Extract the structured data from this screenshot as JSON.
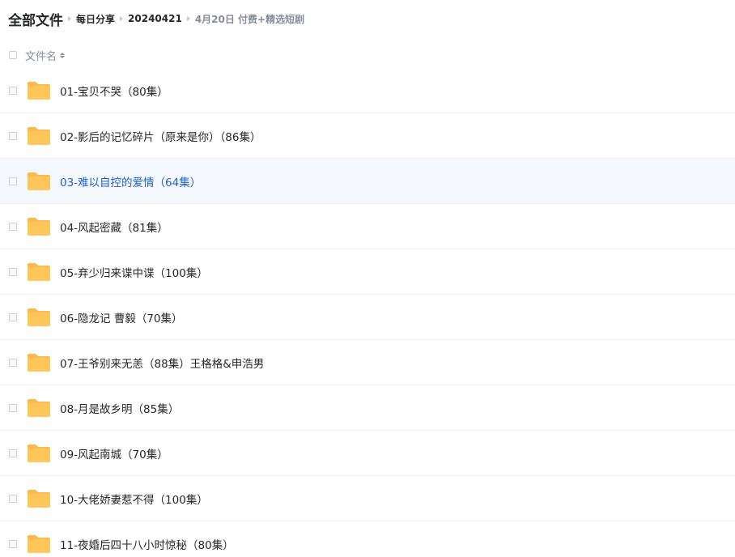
{
  "breadcrumb": {
    "root": "全部文件",
    "items": [
      "每日分享",
      "20240421",
      "4月20日 付费+精选短剧"
    ]
  },
  "list_header": {
    "name_label": "文件名"
  },
  "files": [
    {
      "name": "01-宝贝不哭（80集）"
    },
    {
      "name": "02-影后的记忆碎片（原来是你）（86集）"
    },
    {
      "name": "03-难以自控的爱情（64集）"
    },
    {
      "name": "04-风起密藏（81集）"
    },
    {
      "name": "05-弃少归来谍中谍（100集）"
    },
    {
      "name": "06-隐龙记 曹毅（70集）"
    },
    {
      "name": "07-王爷别来无恙（88集）王格格&申浩男"
    },
    {
      "name": "08-月是故乡明（85集）"
    },
    {
      "name": "09-风起南城（70集）"
    },
    {
      "name": "10-大佬娇妻惹不得（100集）"
    },
    {
      "name": "11-夜婚后四十八小时惊秘（80集）"
    }
  ],
  "hovered_index": 2,
  "colors": {
    "folder": "#ffc75a",
    "folder_back": "#fdb94a",
    "link": "#1f5fd6",
    "hover_bg": "#f5f8ff"
  }
}
